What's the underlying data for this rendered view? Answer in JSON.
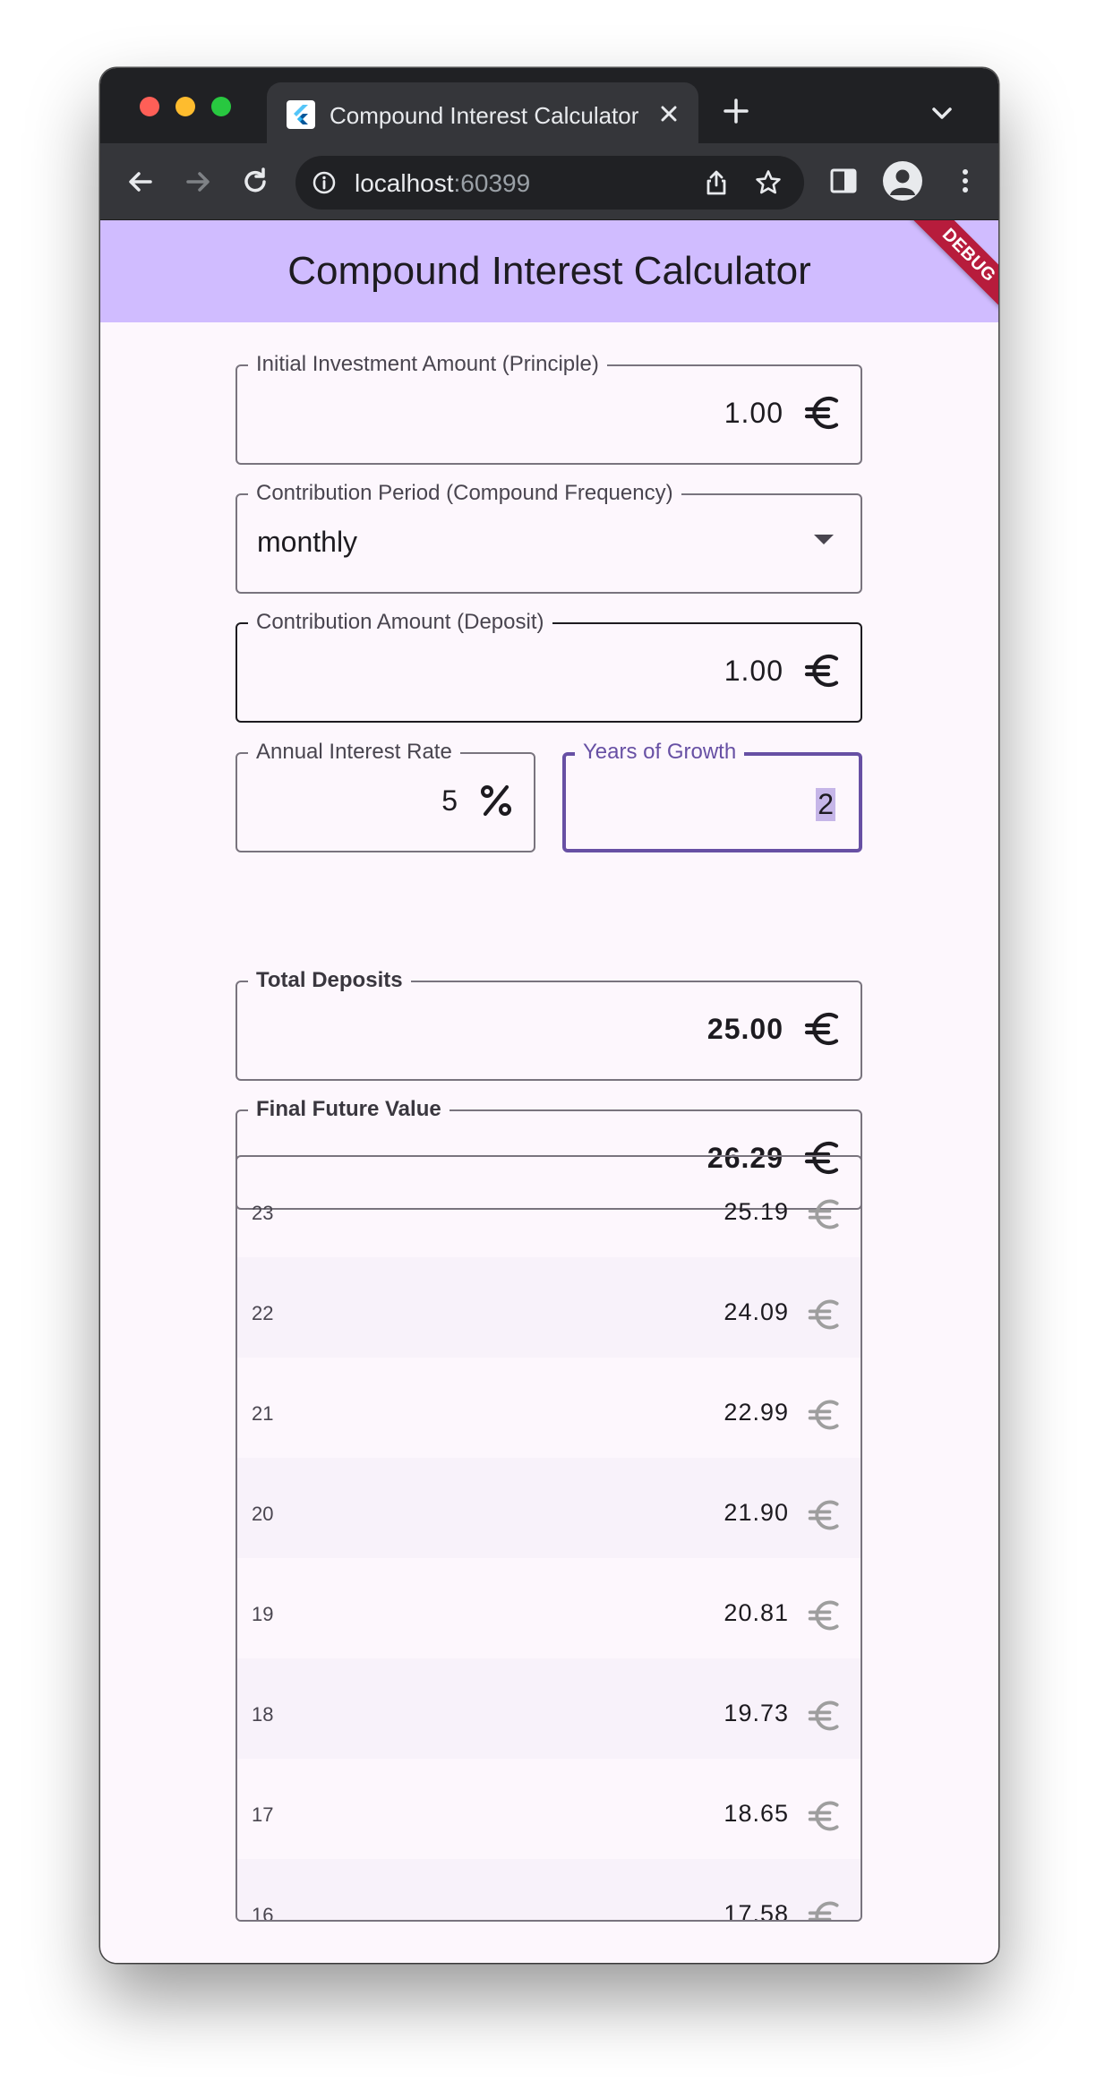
{
  "browser": {
    "tab_title": "Compound Interest Calculator",
    "url_host": "localhost",
    "url_port": ":60399"
  },
  "app": {
    "title": "Compound Interest Calculator",
    "debug_banner": "DEBUG",
    "accent_color": "#6750a4",
    "appbar_color": "#d0bcff"
  },
  "form": {
    "principal": {
      "label": "Initial Investment Amount (Principle)",
      "value": "1.00",
      "suffix_icon": "euro-icon"
    },
    "period": {
      "label": "Contribution Period (Compound Frequency)",
      "value": "monthly"
    },
    "deposit": {
      "label": "Contribution Amount (Deposit)",
      "value": "1.00",
      "suffix_icon": "euro-icon"
    },
    "rate": {
      "label": "Annual Interest Rate",
      "value": "5",
      "suffix_icon": "percent-icon"
    },
    "years": {
      "label": "Years of Growth",
      "value": "2"
    }
  },
  "results": {
    "total_deposits": {
      "label": "Total Deposits",
      "value": "25.00"
    },
    "future_value": {
      "label": "Final Future Value",
      "value": "26.29"
    }
  },
  "history": [
    {
      "index": "23",
      "amount": "25.19"
    },
    {
      "index": "22",
      "amount": "24.09"
    },
    {
      "index": "21",
      "amount": "22.99"
    },
    {
      "index": "20",
      "amount": "21.90"
    },
    {
      "index": "19",
      "amount": "20.81"
    },
    {
      "index": "18",
      "amount": "19.73"
    },
    {
      "index": "17",
      "amount": "18.65"
    },
    {
      "index": "16",
      "amount": "17.58"
    }
  ]
}
